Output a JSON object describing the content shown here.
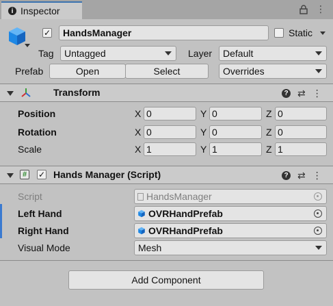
{
  "tab": {
    "label": "Inspector"
  },
  "object": {
    "name": "HandsManager",
    "active": true,
    "static_label": "Static",
    "tag_label": "Tag",
    "tag_value": "Untagged",
    "layer_label": "Layer",
    "layer_value": "Default",
    "prefab_label": "Prefab",
    "open_label": "Open",
    "select_label": "Select",
    "overrides_label": "Overrides"
  },
  "transform": {
    "title": "Transform",
    "rows": [
      {
        "label": "Position",
        "x": "0",
        "y": "0",
        "z": "0"
      },
      {
        "label": "Rotation",
        "x": "0",
        "y": "0",
        "z": "0"
      },
      {
        "label": "Scale",
        "x": "1",
        "y": "1",
        "z": "1"
      }
    ],
    "axis_x": "X",
    "axis_y": "Y",
    "axis_z": "Z"
  },
  "script": {
    "title": "Hands Manager (Script)",
    "script_label": "Script",
    "script_value": "HandsManager",
    "left_hand_label": "Left Hand",
    "left_hand_value": "OVRHandPrefab",
    "right_hand_label": "Right Hand",
    "right_hand_value": "OVRHandPrefab",
    "visual_mode_label": "Visual Mode",
    "visual_mode_value": "Mesh"
  },
  "add_component_label": "Add Component",
  "icons": {
    "header_help": "?",
    "header_presets": "⇄",
    "header_menu": "⋮",
    "check": "✓",
    "hash": "#"
  },
  "colors": {
    "tab_accent": "#3a72b0",
    "cube_blue": "#1e88e5",
    "override_bar": "#3a7ad0"
  }
}
